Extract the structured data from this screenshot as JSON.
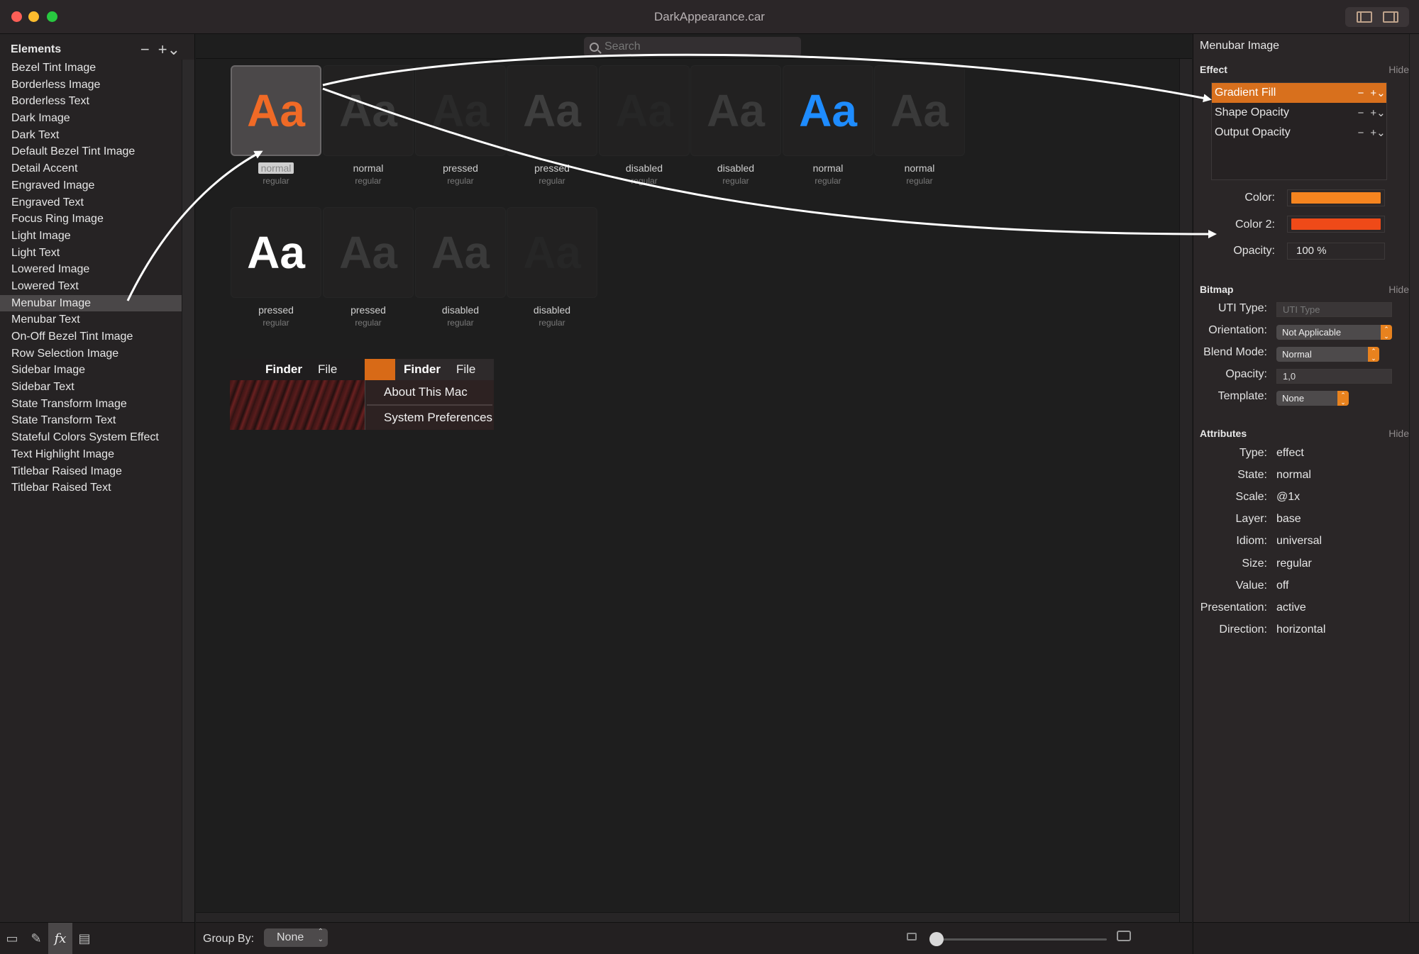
{
  "window": {
    "title": "DarkAppearance.car"
  },
  "sidebar": {
    "title": "Elements",
    "remove_label": "−",
    "add_label": "+⌄",
    "items": [
      "Bezel Tint Image",
      "Borderless Image",
      "Borderless Text",
      "Dark Image",
      "Dark Text",
      "Default Bezel Tint Image",
      "Detail Accent",
      "Engraved Image",
      "Engraved Text",
      "Focus Ring Image",
      "Light Image",
      "Light Text",
      "Lowered Image",
      "Lowered Text",
      "Menubar Image",
      "Menubar Text",
      "On-Off Bezel Tint Image",
      "Row Selection Image",
      "Sidebar Image",
      "Sidebar Text",
      "State Transform Image",
      "State Transform Text",
      "Stateful Colors System Effect",
      "Text Highlight Image",
      "Titlebar Raised Image",
      "Titlebar Raised Text"
    ],
    "selected": "Menubar Image"
  },
  "search": {
    "placeholder": "Search"
  },
  "tiles": [
    {
      "glyph": "Aa",
      "state": "normal",
      "size": "regular",
      "color": "#f06a26",
      "selected": true
    },
    {
      "glyph": "Aa",
      "state": "normal",
      "size": "regular",
      "color": "#3a3a3a"
    },
    {
      "glyph": "Aa",
      "state": "pressed",
      "size": "regular",
      "color": "#2a2a2a"
    },
    {
      "glyph": "Aa",
      "state": "pressed",
      "size": "regular",
      "color": "#3e3e3e"
    },
    {
      "glyph": "Aa",
      "state": "disabled",
      "size": "regular",
      "color": "#262626"
    },
    {
      "glyph": "Aa",
      "state": "disabled",
      "size": "regular",
      "color": "#3a3a3a"
    },
    {
      "glyph": "Aa",
      "state": "normal",
      "size": "regular",
      "color": "#1e8cff"
    },
    {
      "glyph": "Aa",
      "state": "normal",
      "size": "regular",
      "color": "#3a3a3a"
    },
    {
      "glyph": "Aa",
      "state": "pressed",
      "size": "regular",
      "color": "#ffffff"
    },
    {
      "glyph": "Aa",
      "state": "pressed",
      "size": "regular",
      "color": "#3a3a3a"
    },
    {
      "glyph": "Aa",
      "state": "disabled",
      "size": "regular",
      "color": "#3a3a3a"
    },
    {
      "glyph": "Aa",
      "state": "disabled",
      "size": "regular",
      "color": "#262626"
    }
  ],
  "menubar_preview": {
    "apple_glyph": "",
    "app_name": "Finder",
    "menu_file": "File",
    "menu_items": [
      "About This Mac",
      "System Preferences"
    ]
  },
  "bottom_bar": {
    "group_by_label": "Group By:",
    "group_by_value": "None",
    "zoom_fraction": 0.0
  },
  "inspector": {
    "title": "Menubar Image",
    "effect": {
      "header": "Effect",
      "hide": "Hide",
      "items": [
        "Gradient Fill",
        "Shape Opacity",
        "Output Opacity"
      ],
      "selected": "Gradient Fill",
      "color_label": "Color:",
      "color_hex": "#f5841f",
      "color2_label": "Color 2:",
      "color2_hex": "#ef4a18",
      "opacity_label": "Opacity:",
      "opacity_value": "100 %"
    },
    "bitmap": {
      "header": "Bitmap",
      "hide": "Hide",
      "uti_label": "UTI Type:",
      "uti_placeholder": "UTI Type",
      "orientation_label": "Orientation:",
      "orientation_value": "Not Applicable",
      "blend_label": "Blend Mode:",
      "blend_value": "Normal",
      "opacity_label": "Opacity:",
      "opacity_value": "1,0",
      "template_label": "Template:",
      "template_value": "None"
    },
    "attributes": {
      "header": "Attributes",
      "hide": "Hide",
      "rows": [
        {
          "label": "Type:",
          "value": "effect"
        },
        {
          "label": "State:",
          "value": "normal"
        },
        {
          "label": "Scale:",
          "value": "@1x"
        },
        {
          "label": "Layer:",
          "value": "base"
        },
        {
          "label": "Idiom:",
          "value": "universal"
        },
        {
          "label": "Size:",
          "value": "regular"
        },
        {
          "label": "Value:",
          "value": "off"
        },
        {
          "label": "Presentation:",
          "value": "active"
        },
        {
          "label": "Direction:",
          "value": "horizontal"
        }
      ]
    }
  },
  "colors": {
    "accent": "#d8701d"
  }
}
